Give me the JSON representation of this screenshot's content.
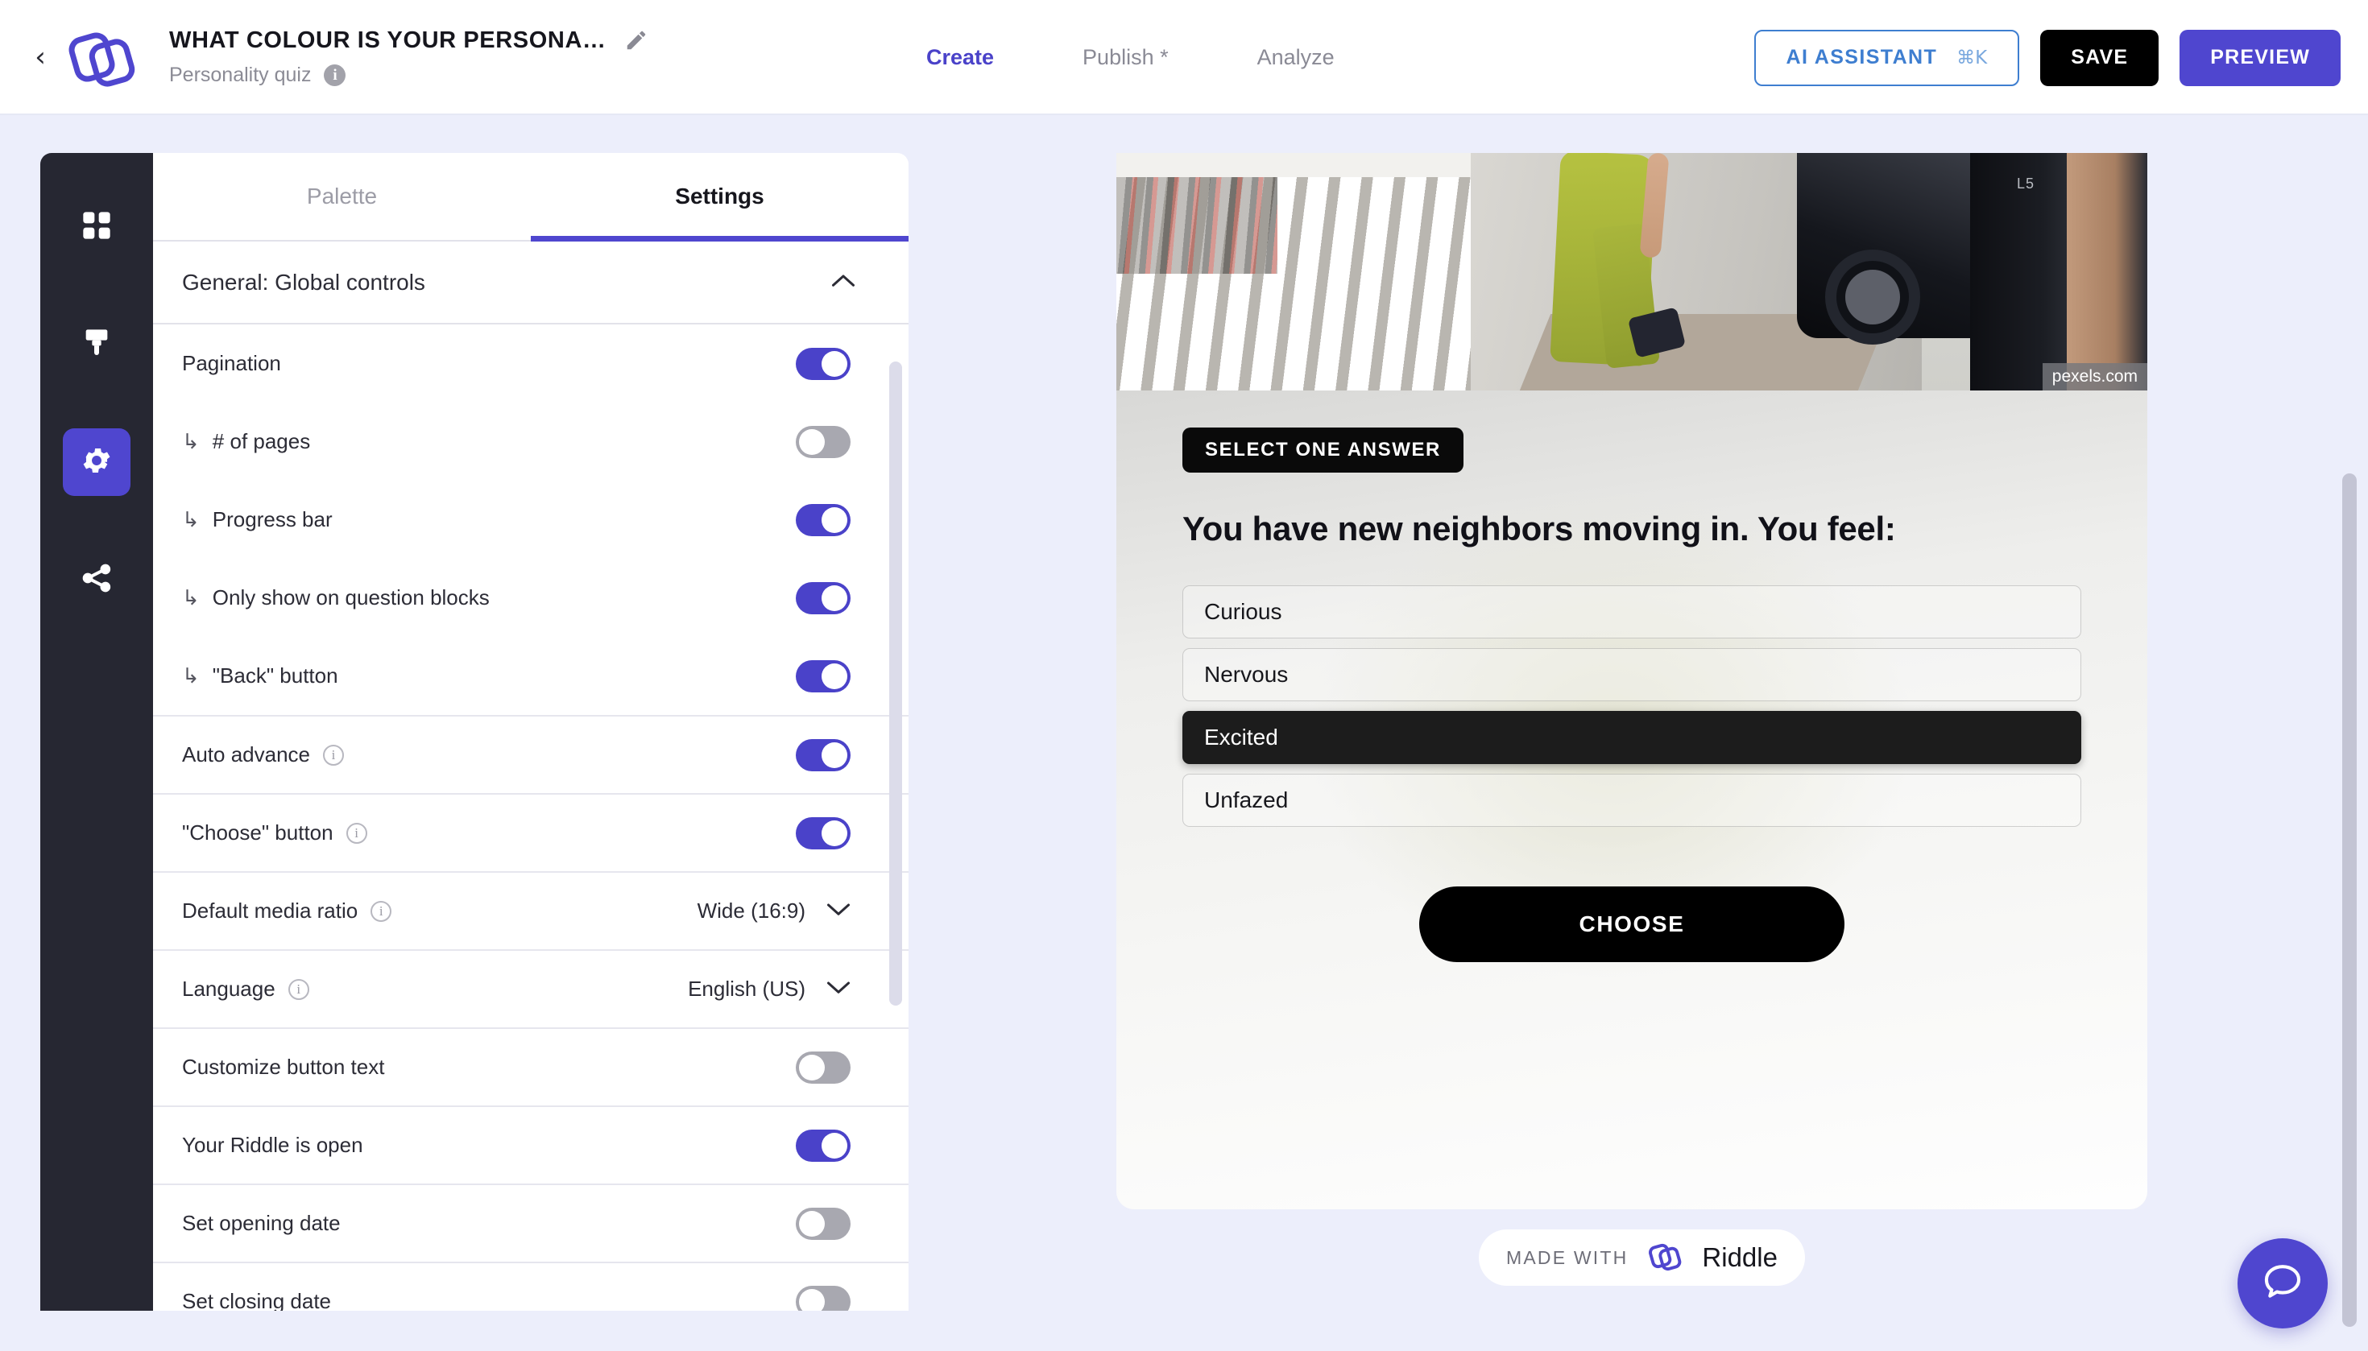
{
  "topbar": {
    "back_icon": "chevron-left-icon",
    "logo_icon": "riddle-logo-icon",
    "title": "WHAT COLOUR IS YOUR PERSONA…",
    "edit_icon": "pencil-icon",
    "subtitle": "Personality quiz",
    "subtitle_info_icon": "info-icon",
    "nav": [
      {
        "label": "Create",
        "active": true
      },
      {
        "label": "Publish *",
        "active": false
      },
      {
        "label": "Analyze",
        "active": false
      }
    ],
    "ai_assistant": {
      "label": "AI ASSISTANT",
      "shortcut": "⌘K"
    },
    "save_label": "SAVE",
    "preview_label": "PREVIEW"
  },
  "rail": {
    "items": [
      {
        "icon": "grid-blocks-icon",
        "active": false
      },
      {
        "icon": "paint-brush-icon",
        "active": false
      },
      {
        "icon": "gear-icon",
        "active": true
      },
      {
        "icon": "share-nodes-icon",
        "active": false
      }
    ]
  },
  "panel": {
    "tabs": [
      {
        "label": "Palette",
        "active": false
      },
      {
        "label": "Settings",
        "active": true
      }
    ],
    "section": {
      "title": "General: Global controls",
      "collapse_icon": "chevron-up-icon",
      "expanded": true
    },
    "rows": [
      {
        "label": "Pagination",
        "indent": false,
        "info": false,
        "control": "toggle",
        "state": "on",
        "bordered": false
      },
      {
        "label": "# of pages",
        "indent": true,
        "info": false,
        "control": "toggle",
        "state": "off",
        "bordered": false
      },
      {
        "label": "Progress bar",
        "indent": true,
        "info": false,
        "control": "toggle",
        "state": "on",
        "bordered": false
      },
      {
        "label": "Only show on question blocks",
        "indent": true,
        "info": false,
        "control": "toggle",
        "state": "on",
        "bordered": false
      },
      {
        "label": "\"Back\" button",
        "indent": true,
        "info": false,
        "control": "toggle",
        "state": "on",
        "bordered": false
      },
      {
        "label": "Auto advance",
        "indent": false,
        "info": true,
        "control": "toggle",
        "state": "on",
        "bordered": true
      },
      {
        "label": "\"Choose\" button",
        "indent": false,
        "info": true,
        "control": "toggle",
        "state": "on",
        "bordered": true
      },
      {
        "label": "Default media ratio",
        "indent": false,
        "info": true,
        "control": "select",
        "value": "Wide (16:9)",
        "bordered": true
      },
      {
        "label": "Language",
        "indent": false,
        "info": true,
        "control": "select",
        "value": "English (US)",
        "bordered": true
      },
      {
        "label": "Customize button text",
        "indent": false,
        "info": false,
        "control": "toggle",
        "state": "off",
        "bordered": true
      },
      {
        "label": "Your Riddle is open",
        "indent": false,
        "info": false,
        "control": "toggle",
        "state": "on",
        "bordered": true
      },
      {
        "label": "Set opening date",
        "indent": false,
        "info": false,
        "control": "toggle",
        "state": "off",
        "bordered": true
      },
      {
        "label": "Set closing date",
        "indent": false,
        "info": false,
        "control": "toggle",
        "state": "off",
        "bordered": true
      }
    ],
    "indent_glyph": "↳",
    "select_chevron": "chevron-down-icon"
  },
  "preview": {
    "hero": {
      "watermark": "pexels.com",
      "plate_text": "L5"
    },
    "badge": "SELECT ONE ANSWER",
    "question": "You have new neighbors moving in. You feel:",
    "answers": [
      {
        "label": "Curious",
        "selected": false
      },
      {
        "label": "Nervous",
        "selected": false
      },
      {
        "label": "Excited",
        "selected": true
      },
      {
        "label": "Unfazed",
        "selected": false
      }
    ],
    "choose_label": "CHOOSE"
  },
  "footer": {
    "made_with_label": "MADE WITH",
    "brand_name": "Riddle",
    "brand_icon": "riddle-logo-icon"
  },
  "chat": {
    "icon": "chat-bubble-icon"
  },
  "colors": {
    "accent_purple": "#4f46cf",
    "toggle_on": "#4a42c9",
    "toggle_off": "#a8a8b0",
    "ai_blue": "#3e7ed0",
    "rail_dark": "#262732",
    "page_bg": "#eceefb"
  }
}
